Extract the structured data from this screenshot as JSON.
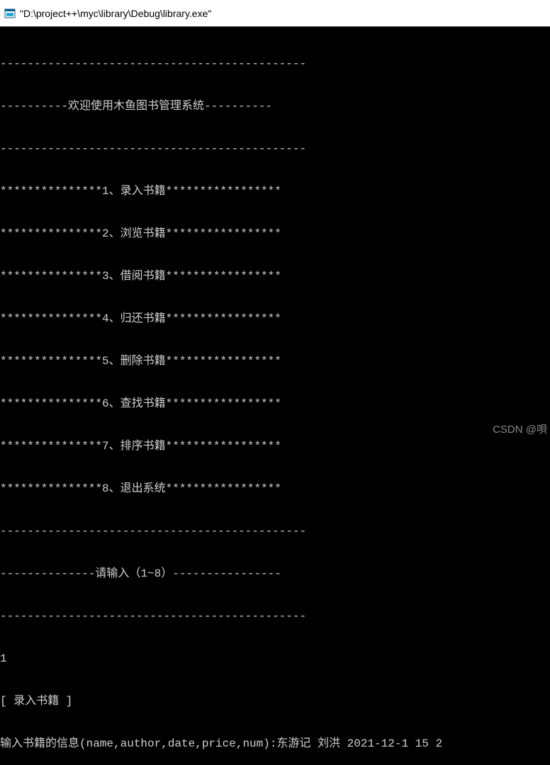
{
  "window": {
    "title": "\"D:\\project++\\myc\\library\\Debug\\library.exe\""
  },
  "console": {
    "divider1": "---------------------------------------------",
    "welcome": "----------欢迎使用木鱼图书管理系统----------",
    "divider2": "---------------------------------------------",
    "menu": [
      "***************1、录入书籍*****************",
      "***************2、浏览书籍*****************",
      "***************3、借阅书籍*****************",
      "***************4、归还书籍*****************",
      "***************5、删除书籍*****************",
      "***************6、查找书籍*****************",
      "***************7、排序书籍*****************",
      "***************8、退出系统*****************"
    ],
    "divider3": "---------------------------------------------",
    "prompt": "--------------请输入（1~8）----------------",
    "divider4": "---------------------------------------------",
    "input_choice": "1",
    "section_title": "[ 录入书籍 ]",
    "input_prompt": "输入书籍的信息(name,author,date,price,num):东游记 刘洪 2021-12-1 15 2"
  },
  "watermark": "CSDN @唄"
}
